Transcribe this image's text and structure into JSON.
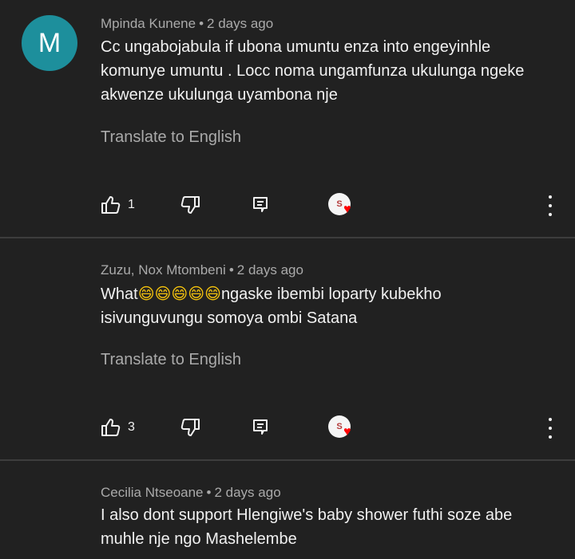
{
  "comments": [
    {
      "avatar_letter": "M",
      "author": "Mpinda Kunene",
      "time": "2 days ago",
      "lines": [
        "Cc ungabojabula if ubona umuntu enza into engeyinhle",
        "komunye umuntu . Locc noma ungamfunza ukulunga ngeke",
        "akwenze ukulunga uyambona nje"
      ],
      "translate": "Translate to English",
      "likes": "1"
    },
    {
      "author": "Zuzu, Nox Mtombeni",
      "time": "2 days ago",
      "line1_prefix": "What",
      "line1_emojis": "😄😄😄😄😄",
      "line1_suffix": "ngaske ibembi loparty kubekho",
      "line2": "isivunguvungu somoya ombi Satana",
      "translate": "Translate to English",
      "likes": "3"
    },
    {
      "author": "Cecilia Ntseoane",
      "time": "2 days ago",
      "lines": [
        "I also dont support Hlengiwe's baby shower futhi soze abe",
        "muhle nje ngo Mashelembe"
      ]
    }
  ],
  "meta_separator": "•",
  "icons": {
    "like": "thumb-up-icon",
    "dislike": "thumb-down-icon",
    "reply": "reply-icon",
    "heart": "creator-heart-icon",
    "more": "more-vert-icon"
  },
  "colors": {
    "background": "#212121",
    "text": "#f1f1f1",
    "secondary": "#aaaaaa",
    "avatar": "#1d8f9c",
    "heart": "#ff0000"
  }
}
